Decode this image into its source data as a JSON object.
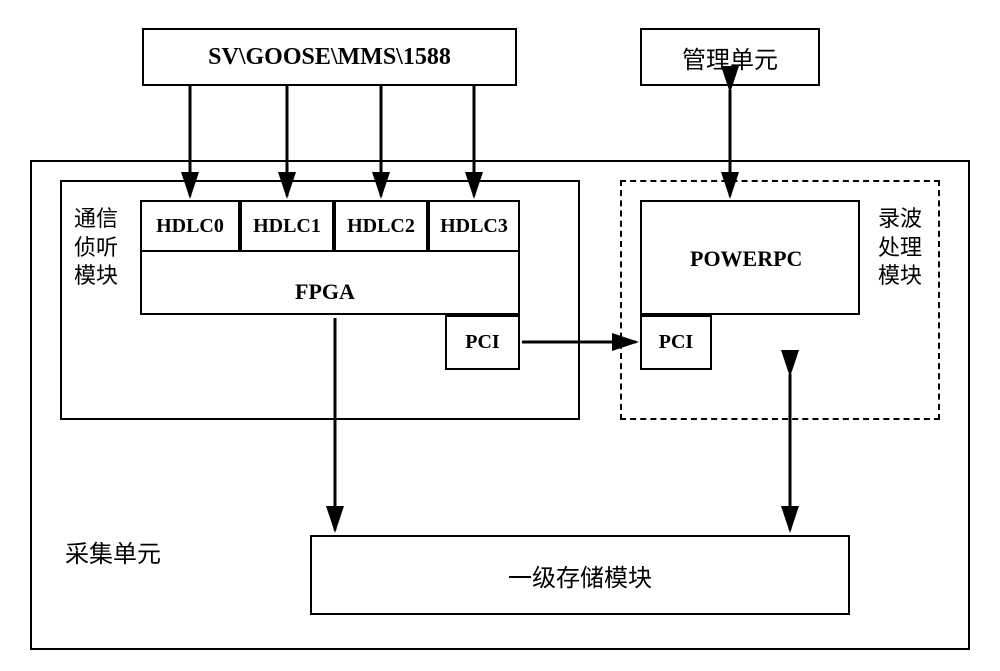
{
  "top": {
    "protocols": "SV\\GOOSE\\MMS\\1588",
    "mgmt_unit": "管理单元"
  },
  "acquisition": {
    "unit_label": "采集单元",
    "comm_module_l1": "通信",
    "comm_module_l2": "侦听",
    "comm_module_l3": "模块",
    "hdlc0": "HDLC0",
    "hdlc1": "HDLC1",
    "hdlc2": "HDLC2",
    "hdlc3": "HDLC3",
    "fpga": "FPGA",
    "pci_left": "PCI",
    "rec_module_l1": "录波",
    "rec_module_l2": "处理",
    "rec_module_l3": "模块",
    "powerpc": "POWERPC",
    "pci_right": "PCI",
    "storage": "一级存储模块"
  }
}
